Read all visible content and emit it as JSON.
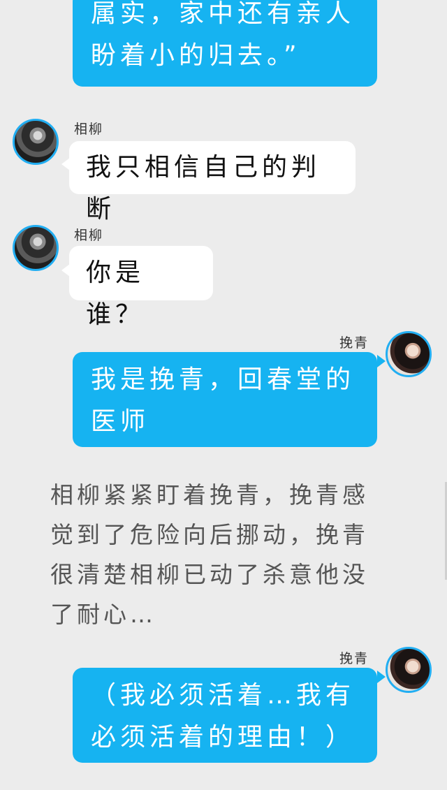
{
  "messages": {
    "m1": {
      "text": "属实，家中还有亲人盼着小的归去。”"
    },
    "m2": {
      "sender": "相柳",
      "text": "我只相信自己的判断"
    },
    "m3": {
      "sender": "相柳",
      "text": "你是谁？"
    },
    "m4": {
      "sender": "挽青",
      "text": "我是挽青，回春堂的医师"
    },
    "m5": {
      "sender": "挽青",
      "text": "（我必须活着…我有必须活着的理由！）"
    }
  },
  "narration": "相柳紧紧盯着挽青，挽青感觉到了危险向后挪动，挽青很清楚相柳已动了杀意他没了耐心…",
  "colors": {
    "background": "#ececec",
    "right_bubble": "#16b3f1",
    "left_bubble": "#ffffff",
    "avatar_ring": "#22aef2"
  }
}
